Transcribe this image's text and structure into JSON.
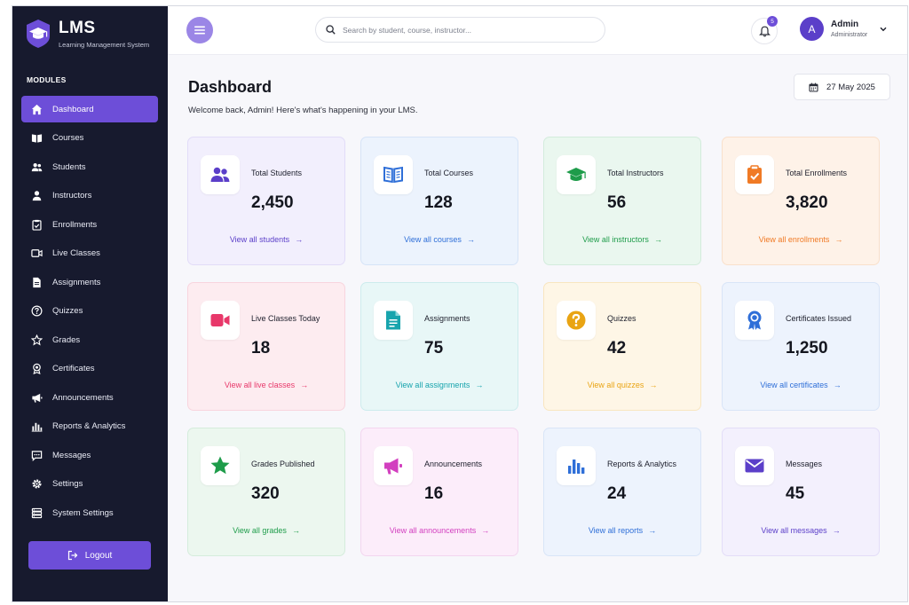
{
  "brand": {
    "title": "LMS",
    "subtitle": "Learning Management System"
  },
  "sidebar": {
    "section_label": "MODULES",
    "items": [
      {
        "label": "Dashboard",
        "icon": "home-icon",
        "active": true
      },
      {
        "label": "Courses",
        "icon": "book-icon"
      },
      {
        "label": "Students",
        "icon": "users-icon"
      },
      {
        "label": "Instructors",
        "icon": "user-icon"
      },
      {
        "label": "Enrollments",
        "icon": "clipboard-icon"
      },
      {
        "label": "Live Classes",
        "icon": "video-icon"
      },
      {
        "label": "Assignments",
        "icon": "file-icon"
      },
      {
        "label": "Quizzes",
        "icon": "question-icon"
      },
      {
        "label": "Grades",
        "icon": "star-icon"
      },
      {
        "label": "Certificates",
        "icon": "award-icon"
      },
      {
        "label": "Announcements",
        "icon": "megaphone-icon"
      },
      {
        "label": "Reports & Analytics",
        "icon": "bar-chart-icon"
      },
      {
        "label": "Messages",
        "icon": "chat-icon"
      },
      {
        "label": "Settings",
        "icon": "gear-icon"
      },
      {
        "label": "System Settings",
        "icon": "server-icon"
      }
    ],
    "logout_label": "Logout"
  },
  "header": {
    "search_placeholder": "Search by student, course, instructor...",
    "notification_count": "5",
    "user": {
      "initial": "A",
      "name": "Admin",
      "role": "Administrator"
    }
  },
  "main": {
    "title": "Dashboard",
    "welcome": "Welcome back, Admin! Here's what's happening in your LMS.",
    "date": "27 May 2025",
    "cards": [
      {
        "label": "Total Students",
        "value": "2,450",
        "link": "View all students",
        "icon": "users-icon",
        "accent": "#5b3fc9",
        "bg": "#f2effd",
        "border": "#e2dcf8"
      },
      {
        "label": "Total Courses",
        "value": "128",
        "link": "View all courses",
        "icon": "book-open-icon",
        "accent": "#2f6fd8",
        "bg": "#ecf3fd",
        "border": "#d6e4f7"
      },
      {
        "label": "Total Instructors",
        "value": "56",
        "link": "View all instructors",
        "icon": "graduation-cap-icon",
        "accent": "#1e9c4a",
        "bg": "#eaf7ef",
        "border": "#d3ecdc"
      },
      {
        "label": "Total Enrollments",
        "value": "3,820",
        "link": "View all enrollments",
        "icon": "clipboard-check-icon",
        "accent": "#f07a25",
        "bg": "#fef2e8",
        "border": "#f9e0cb"
      },
      {
        "label": "Live Classes Today",
        "value": "18",
        "link": "View all live classes",
        "icon": "video-icon",
        "accent": "#e8386a",
        "bg": "#fdecf0",
        "border": "#f8d5de"
      },
      {
        "label": "Assignments",
        "value": "75",
        "link": "View all assignments",
        "icon": "document-icon",
        "accent": "#17a4ad",
        "bg": "#e8f7f7",
        "border": "#cdeced"
      },
      {
        "label": "Quizzes",
        "value": "42",
        "link": "View all quizzes",
        "icon": "question-icon",
        "accent": "#e9a413",
        "bg": "#fef6e6",
        "border": "#f8e6c0"
      },
      {
        "label": "Certificates Issued",
        "value": "1,250",
        "link": "View all certificates",
        "icon": "award-icon",
        "accent": "#2f6fd8",
        "bg": "#edf3fd",
        "border": "#d9e5f7"
      },
      {
        "label": "Grades Published",
        "value": "320",
        "link": "View all grades",
        "icon": "star-icon",
        "accent": "#1e9c4a",
        "bg": "#ecf7ef",
        "border": "#d5ecdc"
      },
      {
        "label": "Announcements",
        "value": "16",
        "link": "View all announcements",
        "icon": "megaphone-icon",
        "accent": "#d23fbf",
        "bg": "#fcedfa",
        "border": "#f3d6ef"
      },
      {
        "label": "Reports & Analytics",
        "value": "24",
        "link": "View all reports",
        "icon": "bar-chart-icon",
        "accent": "#2f6fd8",
        "bg": "#edf3fd",
        "border": "#d9e5f7"
      },
      {
        "label": "Messages",
        "value": "45",
        "link": "View all messages",
        "icon": "mail-icon",
        "accent": "#5b3fc9",
        "bg": "#f3f0fd",
        "border": "#e3ddf8"
      }
    ]
  },
  "colors": {
    "sidebar_bg": "#171a2e",
    "accent": "#6d4ed8"
  }
}
